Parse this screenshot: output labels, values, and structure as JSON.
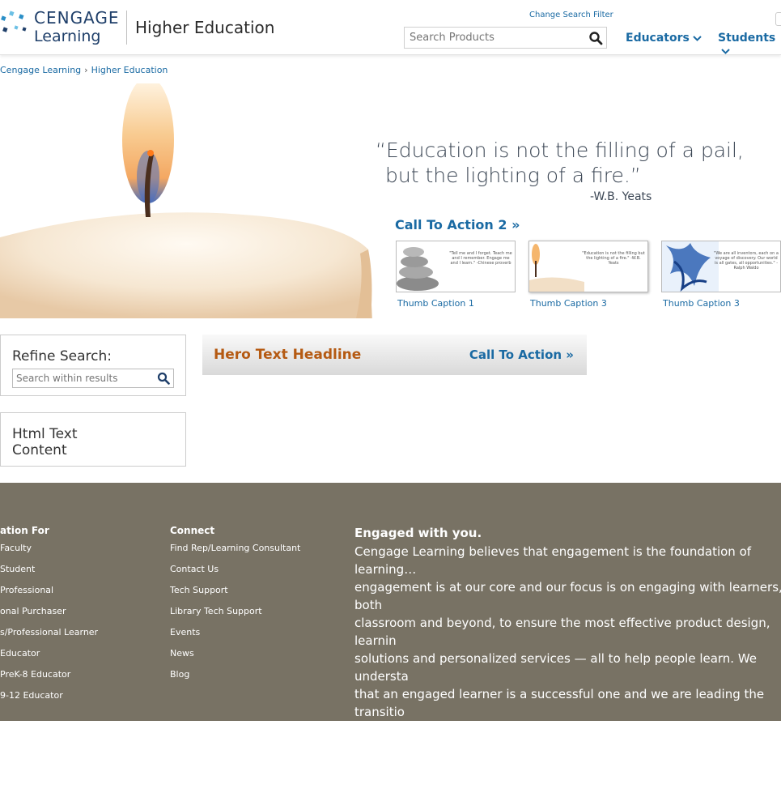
{
  "header": {
    "logo_line1": "CENGAGE",
    "logo_line2": "Learning",
    "title": "Higher Education",
    "filter_link": "Change Search Filter",
    "search_placeholder": "Search Products",
    "nav": [
      {
        "label": "Educators"
      },
      {
        "label": "Students"
      }
    ]
  },
  "breadcrumb": {
    "items": [
      "Cengage Learning",
      "Higher Education"
    ]
  },
  "hero": {
    "quote_line1": "“Education is not the filling of a pail,",
    "quote_line2": "but the lighting of a fire.”",
    "author": "-W.B. Yeats",
    "cta2": "Call To Action 2",
    "thumbs": [
      {
        "caption": "Thumb Caption 1",
        "text": "\"Tell me and I forget. Teach me and I remember. Engage me and I learn.\" -Chinese proverb"
      },
      {
        "caption": "Thumb Caption 3",
        "text": "\"Education is not the filling but the lighting of a fire.\" -W.B. Yeats"
      },
      {
        "caption": "Thumb Caption 3",
        "text": "\"We are all inventors, each on a voyage of discovery. Our world is all gates, all opportunities.\" -Ralph Waldo"
      }
    ]
  },
  "refine": {
    "title": "Refine Search:",
    "placeholder": "Search within results"
  },
  "html_text": "Html Text Content",
  "hero_bar": {
    "headline": "Hero Text Headline",
    "cta": "Call To Action"
  },
  "footer": {
    "col1_title": "ation For",
    "col1_links": [
      "Faculty",
      "Student",
      "Professional",
      "onal Purchaser",
      "s/Professional Learner",
      "Educator",
      "PreK-8 Educator",
      "9-12 Educator"
    ],
    "col2_title": "Connect",
    "col2_links": [
      "Find Rep/Learning Consultant",
      "Contact Us",
      "Tech Support",
      "Library Tech Support",
      "Events",
      "News",
      "Blog"
    ],
    "about_title": "Engaged with you.",
    "about_body": "Cengage Learning believes that engagement is the foundation of learning…\nengagement is at our core and our focus is on engaging with learners, both\nclassroom and beyond, to ensure the most effective product design, learnin\nsolutions and personalized services — all to help people learn. We understa\nthat an engaged learner is a successful one and we are leading the transitio\ndigital with a unique faculty AND student perspective to transform learning\nthrough engagement. Our name itself reinforces this core commitment —\n“engage” is at the “center” of all we do."
  },
  "colors": {
    "link": "#1a6aa3",
    "headline": "#b55a12",
    "footer_bg": "#787264"
  }
}
